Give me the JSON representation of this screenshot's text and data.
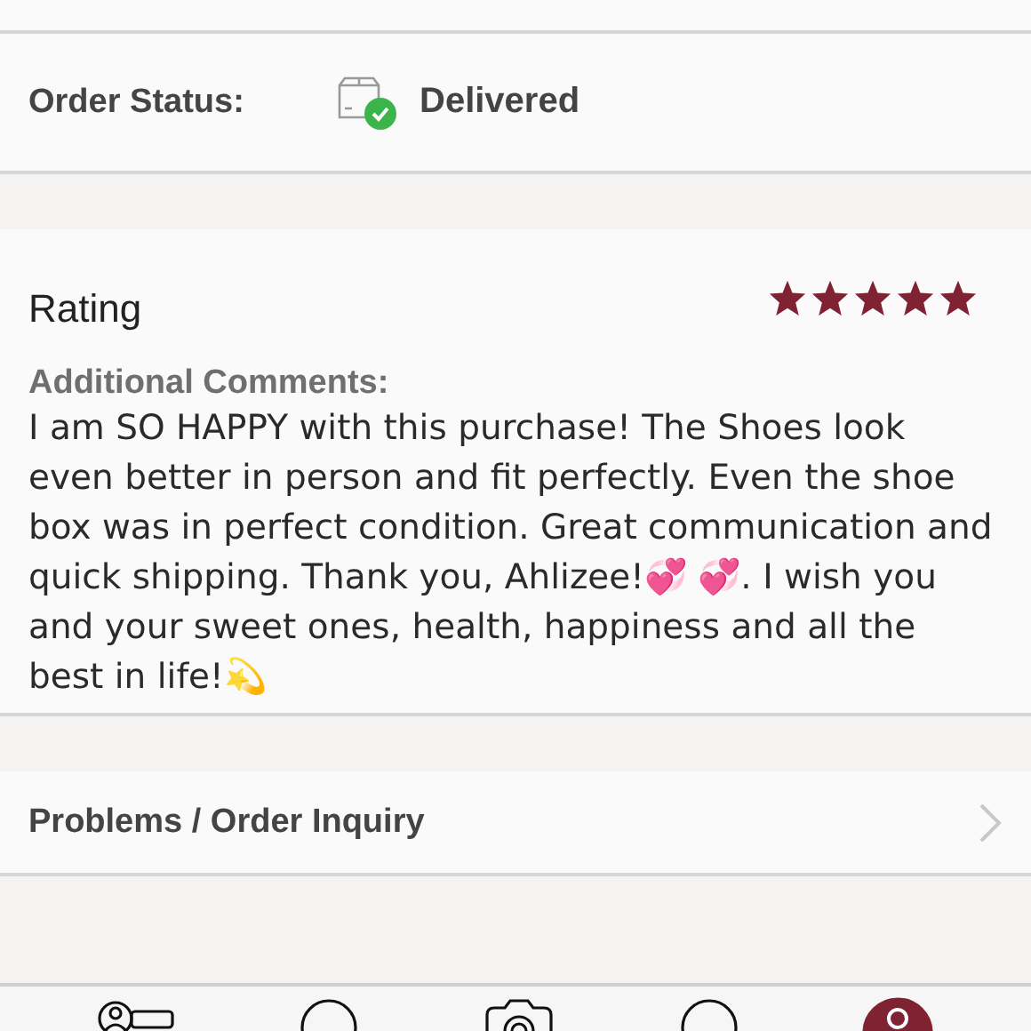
{
  "order_status": {
    "label": "Order Status:",
    "status": "Delivered",
    "delivered": true
  },
  "rating": {
    "title": "Rating",
    "stars": 5
  },
  "comments": {
    "label": "Additional Comments:",
    "text": "I am SO HAPPY with this purchase! The Shoes look even better in person and fit perfectly. Even the shoe box was in perfect condition. Great communication and quick shipping. Thank you, Ahlizee!💞 💞. I wish you and your sweet ones, health, happiness and all the best in life!💫"
  },
  "inquiry": {
    "label": "Problems / Order Inquiry"
  },
  "tab_bar": [
    {
      "kind": "profile-card",
      "selected": false
    },
    {
      "kind": "circle",
      "selected": false
    },
    {
      "kind": "camera",
      "selected": false
    },
    {
      "kind": "circle",
      "selected": false
    },
    {
      "kind": "person",
      "selected": true
    }
  ]
}
